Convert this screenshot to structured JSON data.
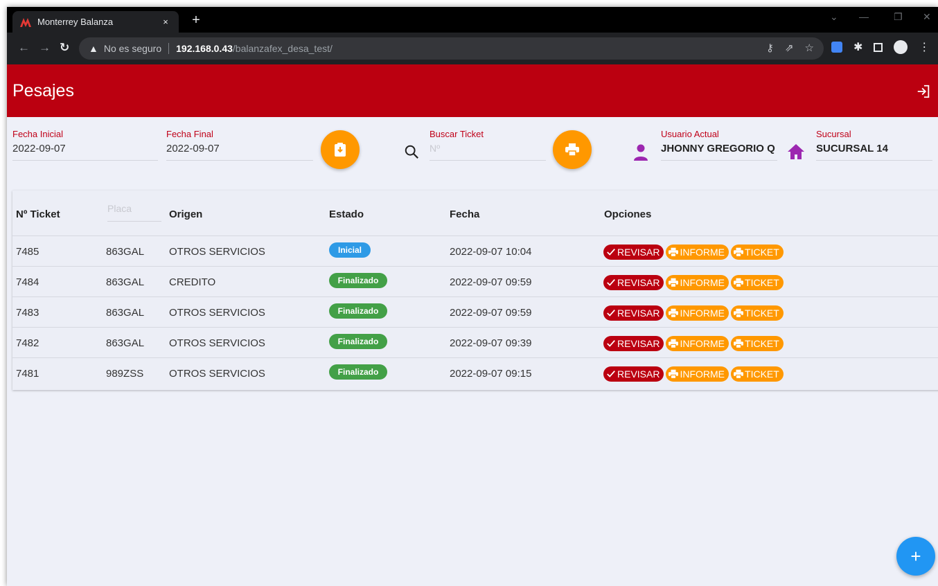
{
  "browser": {
    "tab_title": "Monterrey Balanza",
    "tab_close": "×",
    "new_tab": "+",
    "security_label": "No es seguro",
    "url_host": "192.168.0.43",
    "url_path": "/balanzafex_desa_test/"
  },
  "app": {
    "title": "Pesajes"
  },
  "filters": {
    "fecha_inicial_label": "Fecha Inicial",
    "fecha_inicial_value": "2022-09-07",
    "fecha_final_label": "Fecha Final",
    "fecha_final_value": "2022-09-07",
    "buscar_label": "Buscar Ticket",
    "buscar_placeholder": "Nº",
    "usuario_label": "Usuario Actual",
    "usuario_value": "JHONNY GREGORIO Q",
    "sucursal_label": "Sucursal",
    "sucursal_value": "SUCURSAL 14"
  },
  "table": {
    "headers": {
      "ticket": "Nº Ticket",
      "placa": "Placa",
      "origen": "Origen",
      "estado": "Estado",
      "fecha": "Fecha",
      "opciones": "Opciones"
    },
    "rows": [
      {
        "ticket": "7485",
        "placa": "863GAL",
        "origen": "OTROS SERVICIOS",
        "estado": "Inicial",
        "fecha": "2022-09-07 10:04"
      },
      {
        "ticket": "7484",
        "placa": "863GAL",
        "origen": "CREDITO",
        "estado": "Finalizado",
        "fecha": "2022-09-07 09:59"
      },
      {
        "ticket": "7483",
        "placa": "863GAL",
        "origen": "OTROS SERVICIOS",
        "estado": "Finalizado",
        "fecha": "2022-09-07 09:59"
      },
      {
        "ticket": "7482",
        "placa": "863GAL",
        "origen": "OTROS SERVICIOS",
        "estado": "Finalizado",
        "fecha": "2022-09-07 09:39"
      },
      {
        "ticket": "7481",
        "placa": "989ZSS",
        "origen": "OTROS SERVICIOS",
        "estado": "Finalizado",
        "fecha": "2022-09-07 09:15"
      }
    ],
    "actions": {
      "revisar": "REVISAR",
      "informe": "INFORME",
      "ticket": "TICKET"
    }
  },
  "fab": {
    "add": "+"
  },
  "colors": {
    "primary": "#bb0010",
    "accent": "#ff9800",
    "inicial": "#2e9ae6",
    "finalizado": "#43a047",
    "fab": "#2196f3",
    "user_icon": "#9c27b0"
  }
}
